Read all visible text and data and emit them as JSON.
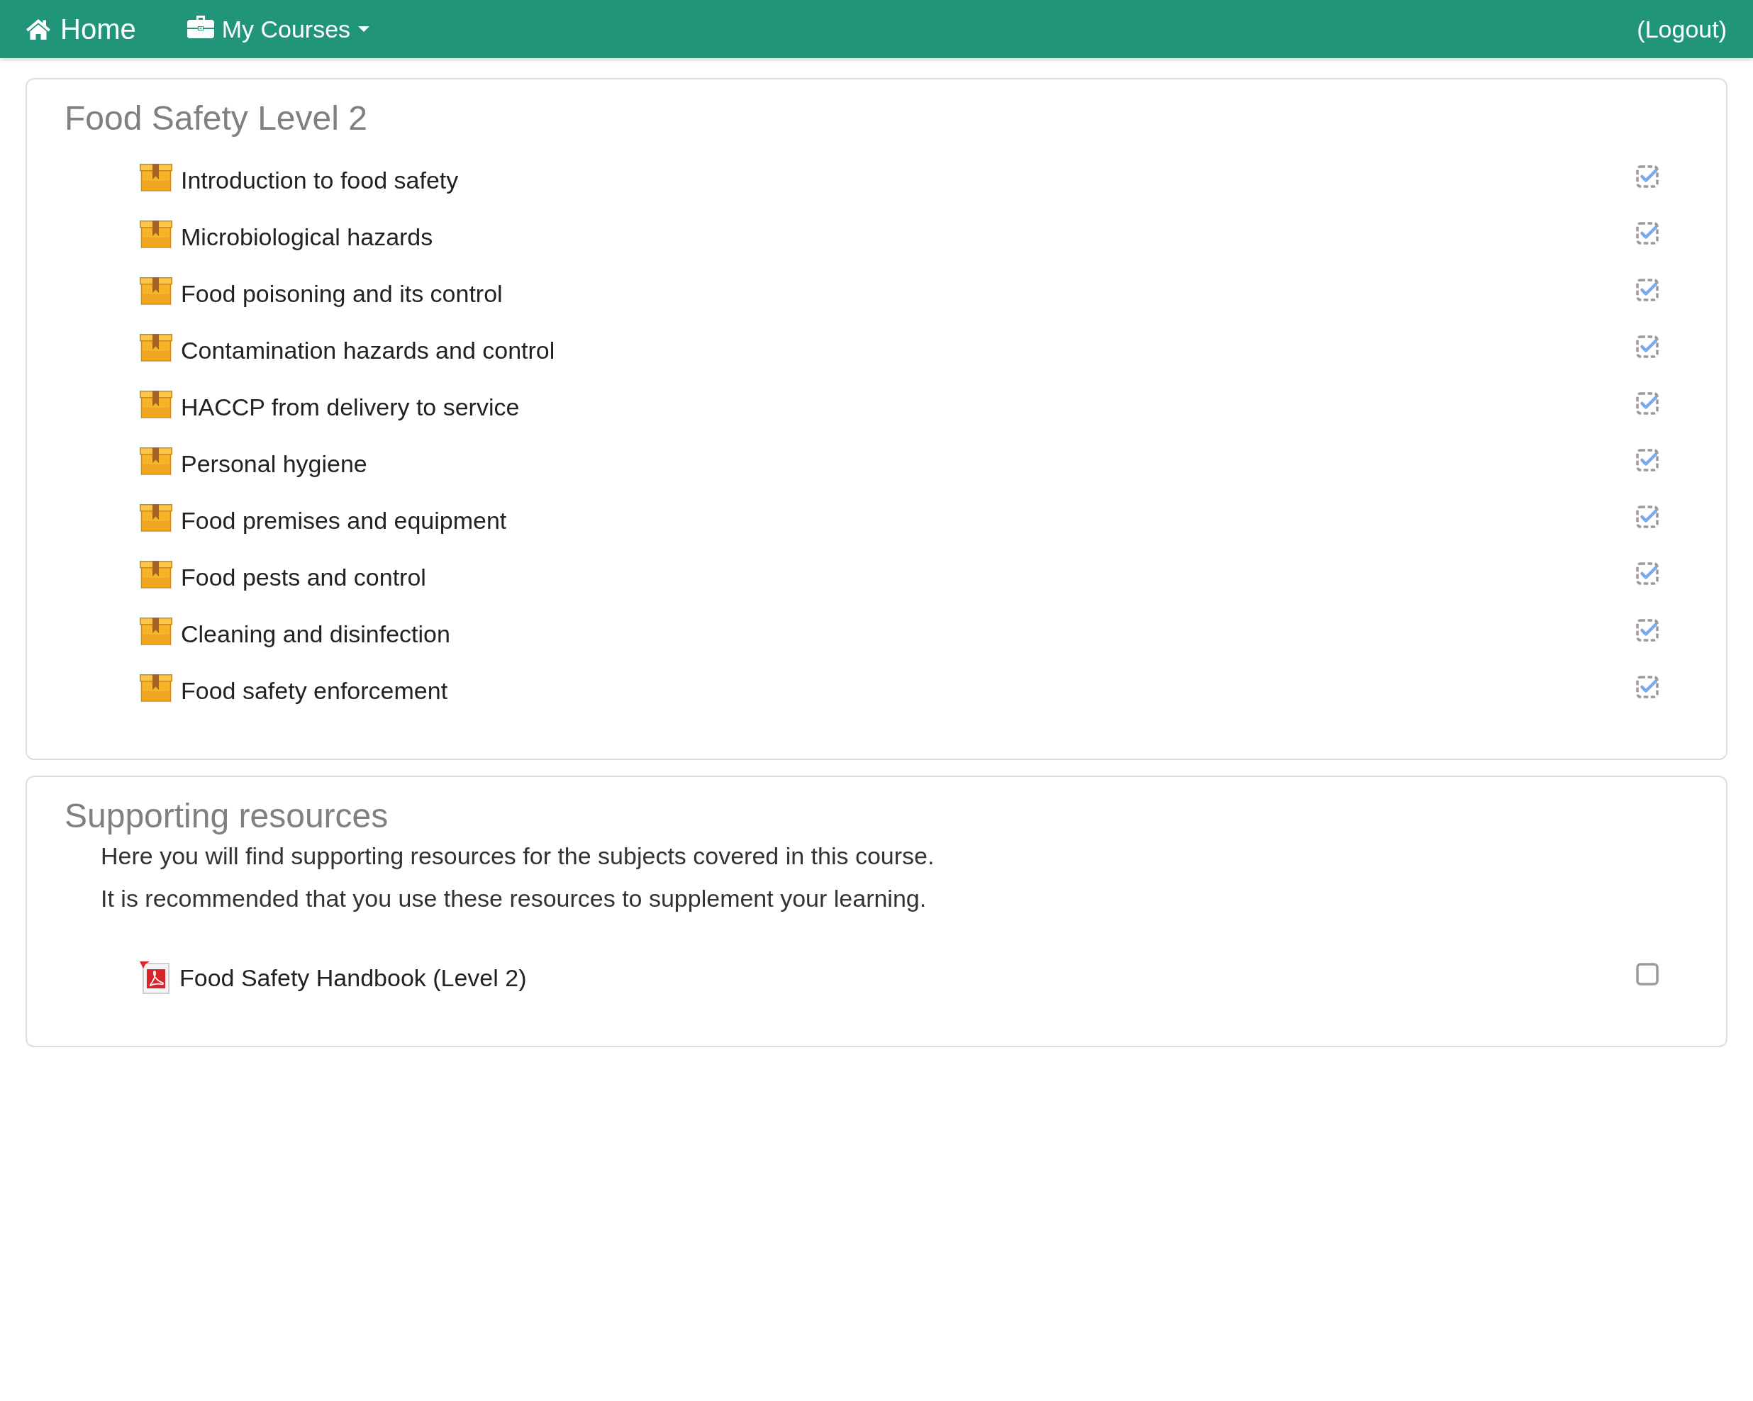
{
  "navbar": {
    "home": "Home",
    "courses_menu": "My Courses",
    "logout": "(Logout)"
  },
  "sections": [
    {
      "title": "Food Safety Level 2",
      "items": [
        {
          "kind": "lesson",
          "label": "Introduction to food safety",
          "automatic": true,
          "checked": true
        },
        {
          "kind": "lesson",
          "label": "Microbiological hazards",
          "automatic": true,
          "checked": true
        },
        {
          "kind": "lesson",
          "label": "Food poisoning and its control",
          "automatic": true,
          "checked": true
        },
        {
          "kind": "lesson",
          "label": "Contamination hazards and control",
          "automatic": true,
          "checked": true
        },
        {
          "kind": "lesson",
          "label": "HACCP from delivery to service",
          "automatic": true,
          "checked": true
        },
        {
          "kind": "lesson",
          "label": "Personal hygiene",
          "automatic": true,
          "checked": true
        },
        {
          "kind": "lesson",
          "label": "Food premises and equipment",
          "automatic": true,
          "checked": true
        },
        {
          "kind": "lesson",
          "label": "Food pests and control",
          "automatic": true,
          "checked": true
        },
        {
          "kind": "lesson",
          "label": "Cleaning and disinfection",
          "automatic": true,
          "checked": true
        },
        {
          "kind": "lesson",
          "label": "Food safety enforcement",
          "automatic": true,
          "checked": true
        }
      ]
    },
    {
      "title": "Supporting resources",
      "paragraphs": [
        "Here you will find supporting resources for the subjects covered in this course.",
        "It is recommended that you use these resources to supplement your learning."
      ],
      "items": [
        {
          "kind": "pdf",
          "label": "Food Safety Handbook (Level 2)",
          "automatic": false,
          "checked": false
        }
      ]
    }
  ]
}
